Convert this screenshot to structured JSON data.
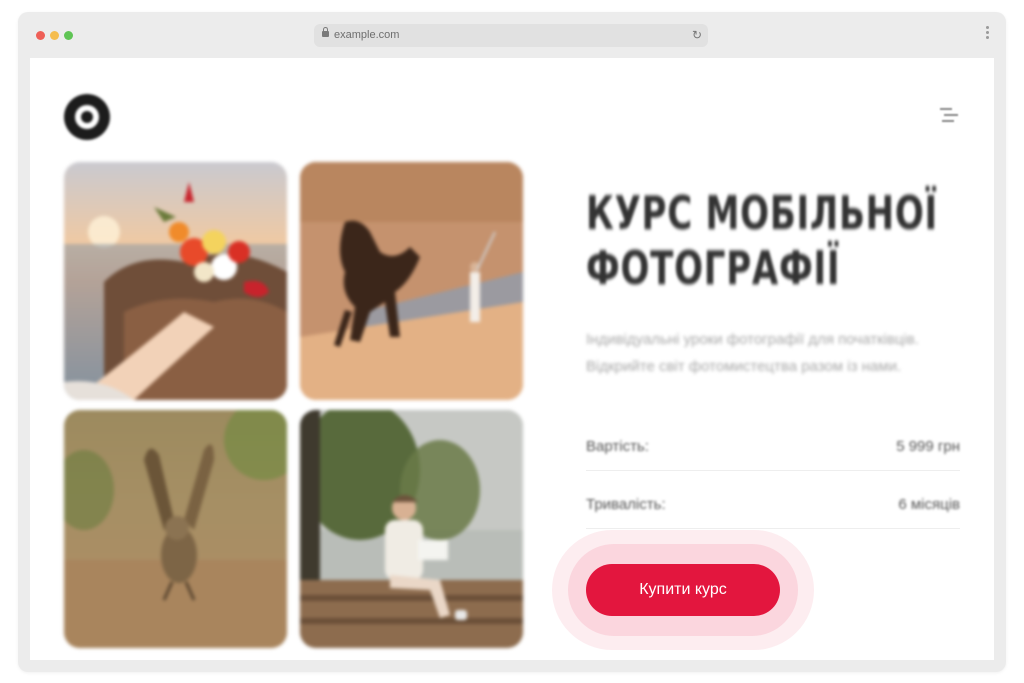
{
  "browser": {
    "url": "example.com",
    "reload_icon": "reload-icon",
    "menu_icon": "kebab-menu-icon"
  },
  "header": {
    "logo_icon": "camera-lens-logo",
    "menu_icon": "menu-icon"
  },
  "gallery": {
    "photos": [
      {
        "subject": "hand holding flower bouquet over seaside sunset"
      },
      {
        "subject": "rearing horse in desert with person"
      },
      {
        "subject": "owl spreading wings on ground"
      },
      {
        "subject": "woman sitting on bench with trees"
      }
    ]
  },
  "course": {
    "title_line1": "КУРС МОБІЛЬНОЇ",
    "title_line2": "ФОТОГРАФІЇ",
    "description": "Індивідуальні уроки фотографії для початківців. Відкрийте світ фотомистецтва разом із нами.",
    "price_label": "Вартість:",
    "price_value": "5 999 грн",
    "duration_label": "Тривалість:",
    "duration_value": "6 місяців",
    "buy_button": "Купити курс"
  },
  "colors": {
    "accent": "#e3163e",
    "title": "#333333",
    "muted": "#a8a8a8"
  }
}
